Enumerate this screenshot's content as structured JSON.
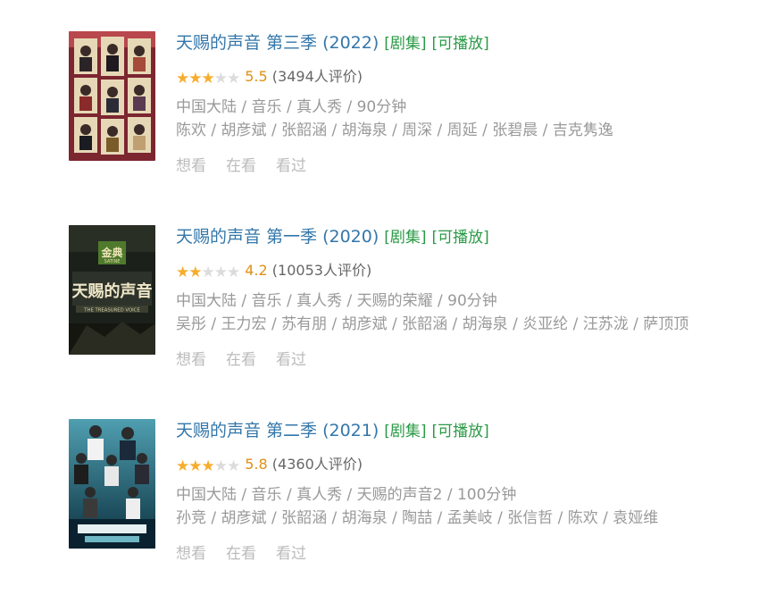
{
  "items": [
    {
      "title": "天赐的声音 第三季 (2022)",
      "tags": [
        "[剧集]",
        "[可播放]"
      ],
      "stars_filled": 3,
      "score": "5.5",
      "votes": "(3494人评价)",
      "meta": "中国大陆 / 音乐 / 真人秀 / 90分钟",
      "cast": "陈欢 / 胡彦斌 / 张韶涵 / 胡海泉 / 周深 / 周延 / 张碧晨 / 吉克隽逸",
      "actions": [
        "想看",
        "在看",
        "看过"
      ],
      "poster_colors": [
        "#8a2a32",
        "#d8c9a6",
        "#3a1e22"
      ]
    },
    {
      "title": "天赐的声音 第一季 (2020)",
      "tags": [
        "[剧集]",
        "[可播放]"
      ],
      "stars_filled": 2,
      "score": "4.2",
      "votes": "(10053人评价)",
      "meta": "中国大陆 / 音乐 / 真人秀 / 天赐的荣耀 / 90分钟",
      "cast": "吴彤 / 王力宏 / 苏有朋 / 胡彦斌 / 张韶涵 / 胡海泉 / 炎亚纶 / 汪苏泷 / 萨顶顶",
      "actions": [
        "想看",
        "在看",
        "看过"
      ],
      "poster_colors": [
        "#1b1f1a",
        "#c9b98a",
        "#4a6a30"
      ],
      "poster_text": {
        "badge": "金典",
        "badge_sub": "SATINE",
        "main": "天赐的声音",
        "sub": "THE TREASURED VOICE"
      }
    },
    {
      "title": "天赐的声音 第二季 (2021)",
      "tags": [
        "[剧集]",
        "[可播放]"
      ],
      "stars_filled": 3,
      "score": "5.8",
      "votes": "(4360人评价)",
      "meta": "中国大陆 / 音乐 / 真人秀 / 天赐的声音2 / 100分钟",
      "cast": "孙竞 / 胡彦斌 / 张韶涵 / 胡海泉 / 陶喆 / 孟美岐 / 张信哲 / 陈欢 / 袁娅维",
      "actions": [
        "想看",
        "在看",
        "看过"
      ],
      "poster_colors": [
        "#0e3a4a",
        "#6fb7c4",
        "#d8e6ea"
      ]
    }
  ]
}
